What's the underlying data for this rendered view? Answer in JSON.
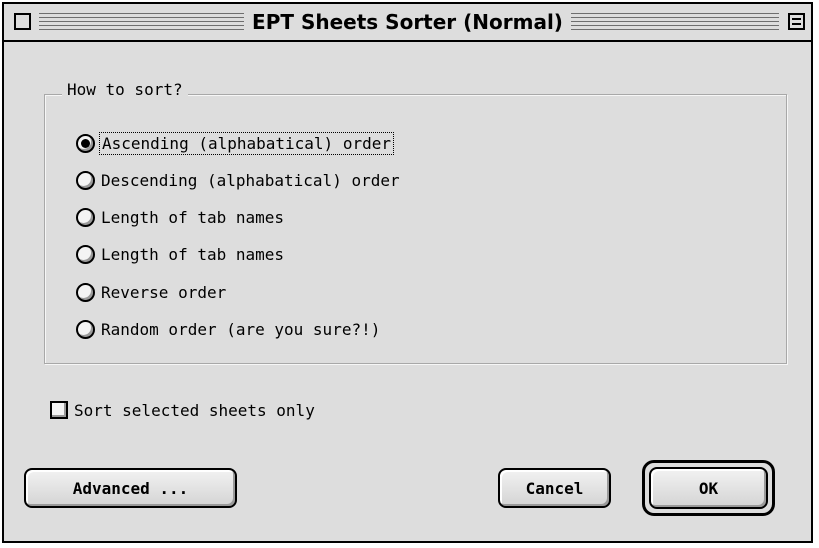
{
  "window": {
    "title": "EPT Sheets Sorter (Normal)"
  },
  "sort_group": {
    "label": "How to sort?",
    "selected_index": 0,
    "options": [
      "Ascending (alphabatical) order",
      "Descending (alphabatical) order",
      "Length of tab names",
      "Length of tab names",
      "Reverse order",
      "Random order (are you sure?!)"
    ]
  },
  "selected_only": {
    "label": "Sort selected sheets only",
    "checked": false
  },
  "buttons": {
    "advanced": "Advanced ...",
    "cancel": "Cancel",
    "ok": "OK"
  }
}
